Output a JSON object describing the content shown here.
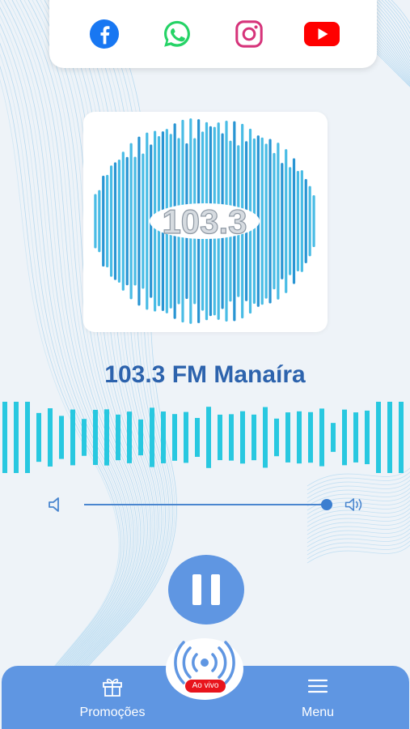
{
  "social": {
    "items": [
      {
        "name": "facebook",
        "icon": "facebook-icon",
        "color": "#1877f2"
      },
      {
        "name": "whatsapp",
        "icon": "whatsapp-icon",
        "color": "#25d366"
      },
      {
        "name": "instagram",
        "icon": "instagram-icon",
        "color": "#d6337a"
      },
      {
        "name": "youtube",
        "icon": "youtube-icon",
        "color": "#ff0000"
      }
    ]
  },
  "logo": {
    "text": "103.3",
    "color": "#3fb8e4"
  },
  "station": {
    "name": "103.3 FM Manaíra"
  },
  "player": {
    "volume": 1.0,
    "state": "playing",
    "controls": {
      "pause_icon": "pause-icon",
      "volume_low_icon": "volume-low-icon",
      "volume_high_icon": "volume-high-icon"
    }
  },
  "visualizer": {
    "color": "#28c8e0"
  },
  "nav": {
    "promo_label": "Promoções",
    "menu_label": "Menu",
    "live_badge": "Ao vivo",
    "background": "#5f96e2"
  },
  "colors": {
    "accent": "#2d63ad",
    "primary": "#5f96e2",
    "live": "#e8141c"
  }
}
